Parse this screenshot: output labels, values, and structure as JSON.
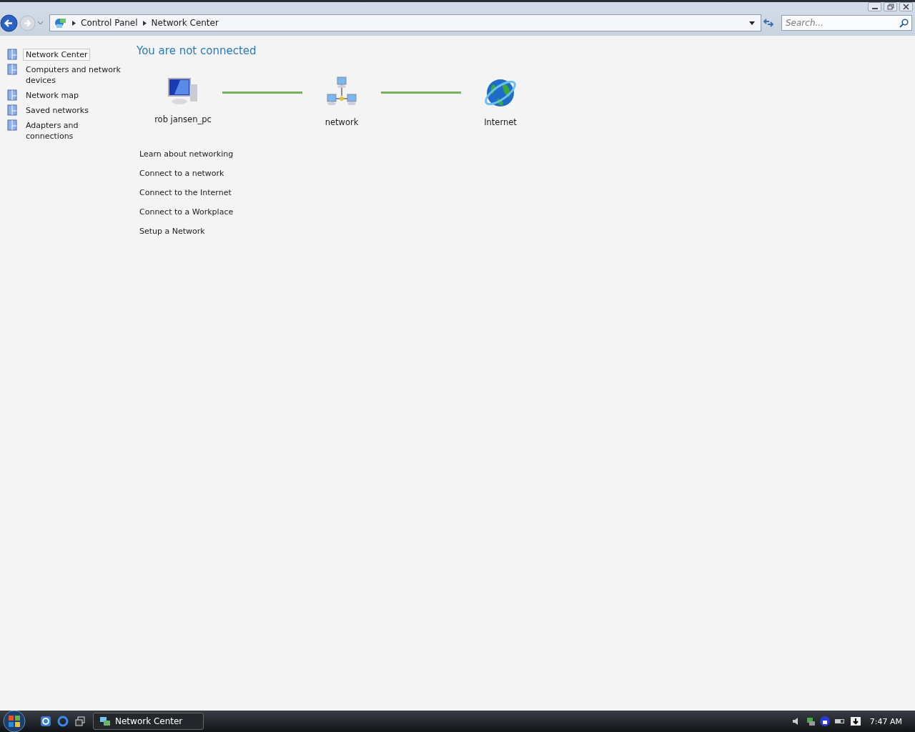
{
  "address_bar": {
    "breadcrumb": [
      "Control Panel",
      "Network Center"
    ]
  },
  "search": {
    "placeholder": "Search..."
  },
  "sidebar": {
    "items": [
      {
        "label": "Network Center",
        "selected": true
      },
      {
        "label": "Computers and network devices",
        "selected": false
      },
      {
        "label": "Network map",
        "selected": false
      },
      {
        "label": "Saved networks",
        "selected": false
      },
      {
        "label": "Adapters and connections",
        "selected": false
      }
    ]
  },
  "heading": "You are not connected",
  "diagram": {
    "nodes": [
      {
        "kind": "computer",
        "label": "rob jansen_pc"
      },
      {
        "kind": "network",
        "label": "network"
      },
      {
        "kind": "internet",
        "label": "Internet"
      }
    ]
  },
  "links": [
    "Learn about networking",
    "Connect to a network",
    "Connect to the Internet",
    "Connect to a Workplace",
    "Setup a Network"
  ],
  "taskbar": {
    "window_button": "Network Center",
    "clock": "7:47 AM"
  }
}
